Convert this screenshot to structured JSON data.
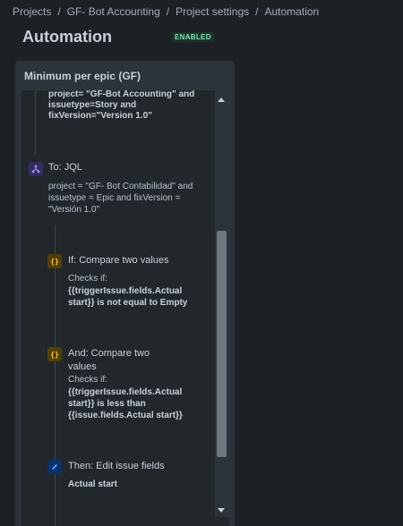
{
  "breadcrumb": {
    "items": [
      "Projects",
      "GF- Bot Accounting",
      "Project settings",
      "Automation"
    ],
    "separator": "/"
  },
  "page": {
    "title": "Automation",
    "status_badge": "ENABLED"
  },
  "panel": {
    "title": "Minimum per epic (GF)",
    "partial_jql": {
      "line1": "project= \"GF-Bot Accounting\" and",
      "line2": "issuetype=Story and",
      "line3": "fixVersion=\"Version 1.0\""
    },
    "branch": {
      "icon": "branch-icon",
      "title": "To: JQL",
      "line1": "project = \"GF- Bot Contabilidad\" and",
      "line2": "issuetype = Epic and fixVersion =",
      "line3": "\"Versión 1.0\""
    },
    "condition1": {
      "icon": "braces-icon",
      "title": "If: Compare two values",
      "checks_label": "Checks if:",
      "line1": "{{triggerIssue.fields.Actual",
      "line2": "start}} is not equal to Empty"
    },
    "condition2": {
      "icon": "braces-icon",
      "title_line1": "And: Compare two",
      "title_line2": "values",
      "checks_label": "Checks if:",
      "line1": "{{triggerIssue.fields.Actual",
      "line2": "start}} is less than",
      "line3": "{{issue.fields.Actual start}}"
    },
    "action": {
      "icon": "pencil-icon",
      "title": "Then: Edit issue fields",
      "field": "Actual start"
    }
  },
  "colors": {
    "background": "#1d2125",
    "panel": "#2c333a",
    "badge_text": "#7ee2b8",
    "condition_icon": "#f5cd47",
    "action_icon": "#579dff",
    "branch_icon": "#9f8fef"
  }
}
